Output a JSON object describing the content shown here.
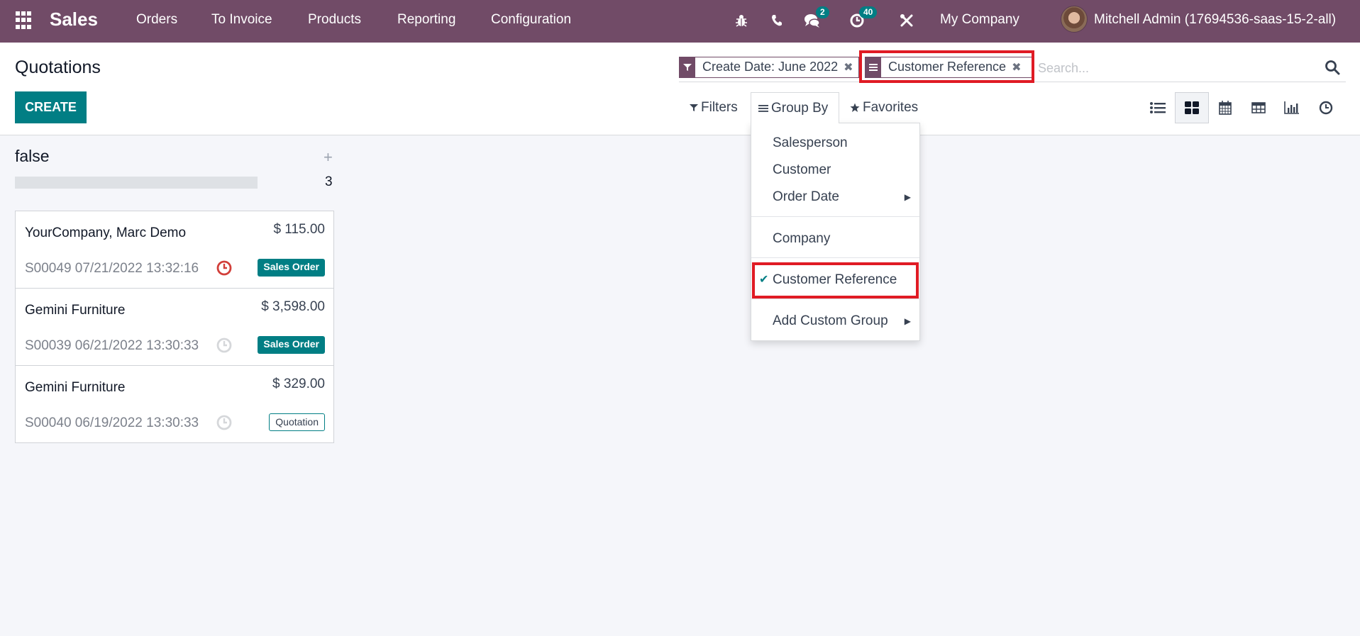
{
  "navbar": {
    "app_name": "Sales",
    "menus": [
      "Orders",
      "To Invoice",
      "Products",
      "Reporting",
      "Configuration"
    ],
    "icons": [
      "bug-icon",
      "phone-icon",
      "chat-icon",
      "activity-icon",
      "tools-icon"
    ],
    "messages_count": "2",
    "activities_count": "40",
    "company": "My Company",
    "user": "Mitchell Admin (17694536-saas-15-2-all)"
  },
  "page": {
    "title": "Quotations",
    "create_label": "CREATE"
  },
  "search": {
    "facets": [
      {
        "icon": "filter-icon",
        "label": "Create Date: June 2022"
      },
      {
        "icon": "group-by-icon",
        "label": "Customer Reference"
      }
    ],
    "placeholder": "Search..."
  },
  "toolbar": {
    "filters_label": "Filters",
    "group_by_label": "Group By",
    "favorites_label": "Favorites",
    "views": [
      "list",
      "kanban",
      "calendar",
      "pivot",
      "graph",
      "activity"
    ],
    "active_view": "kanban"
  },
  "group_by_menu": {
    "items": [
      {
        "label": "Salesperson",
        "checked": false,
        "submenu": false
      },
      {
        "label": "Customer",
        "checked": false,
        "submenu": false
      },
      {
        "label": "Order Date",
        "checked": false,
        "submenu": true
      },
      {
        "label": "Company",
        "checked": false,
        "submenu": false
      },
      {
        "label": "Customer Reference",
        "checked": true,
        "submenu": false
      },
      {
        "label": "Add Custom Group",
        "checked": false,
        "submenu": true
      }
    ]
  },
  "kanban": {
    "column": {
      "title": "false",
      "count": "3",
      "progress": 0
    },
    "cards": [
      {
        "customer": "YourCompany, Marc Demo",
        "amount": "$ 115.00",
        "reference": "S00049 07/21/2022 13:32:16",
        "activity": "overdue",
        "status": "Sales Order"
      },
      {
        "customer": "Gemini Furniture",
        "amount": "$ 3,598.00",
        "reference": "S00039 06/21/2022 13:30:33",
        "activity": "none",
        "status": "Sales Order"
      },
      {
        "customer": "Gemini Furniture",
        "amount": "$ 329.00",
        "reference": "S00040 06/19/2022 13:30:33",
        "activity": "none",
        "status": "Quotation"
      }
    ]
  },
  "colors": {
    "brand": "#714b67",
    "primary": "#017e84",
    "highlight": "#e01b24",
    "overdue": "#d23f3a"
  }
}
